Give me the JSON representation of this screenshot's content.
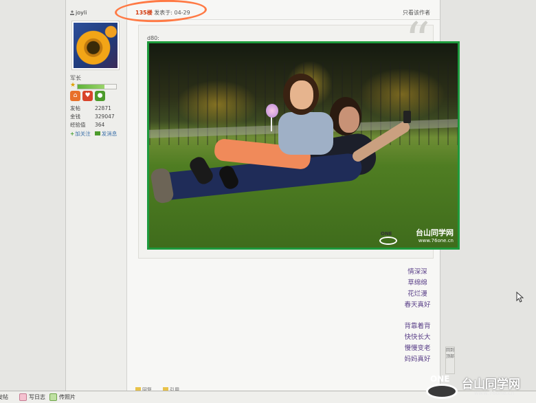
{
  "user": {
    "name": "joyli",
    "rank": "军长",
    "level_progress": 0.7,
    "medals": [
      "house-medal",
      "heart-medal",
      "bear-medal"
    ],
    "stats": [
      {
        "label": "发帖",
        "value": "22871"
      },
      {
        "label": "金钱",
        "value": "329047"
      },
      {
        "label": "经验值",
        "value": "364"
      }
    ],
    "follow": "加关注",
    "message": "发消息"
  },
  "post": {
    "floor_number": "135楼",
    "posted_at": "发表于: 04-29",
    "only_author": "只看该作者",
    "quote_author": "d80:",
    "photo_watermark": {
      "logo": "ONE",
      "name": "台山同学网",
      "url": "www.76one.cn"
    },
    "poem": {
      "stanza1": [
        "情深深",
        "草绵绵",
        "花烂漫",
        "春天真好"
      ],
      "stanza2": [
        "背靠着背",
        "快快长大",
        "慢慢变老",
        "妈妈真好"
      ]
    },
    "scroll_top": "回到顶部"
  },
  "post_bar": {
    "item1": "回复",
    "item2": "引用"
  },
  "taskbar": {
    "item1": "发帖",
    "item2": "写日志",
    "item3": "传照片"
  },
  "watermark": {
    "logo": "ONE",
    "name": "台山同学网",
    "url": "www.76one.cn"
  },
  "colors": {
    "floor_accent": "#d23a0f",
    "photo_border": "#1d9a3c",
    "poem": "#5a3f88",
    "annotation_circle": "#ff7a45"
  }
}
